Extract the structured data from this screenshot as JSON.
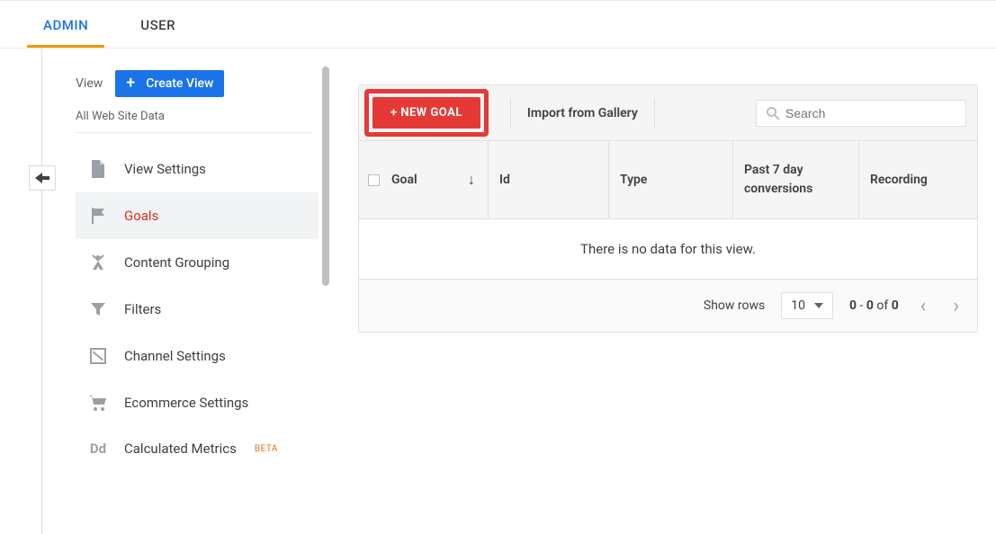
{
  "tabs": {
    "admin": "ADMIN",
    "user": "USER"
  },
  "sidebar": {
    "view_label": "View",
    "create_view": "Create View",
    "property": "All Web Site Data",
    "items": [
      {
        "label": "View Settings"
      },
      {
        "label": "Goals"
      },
      {
        "label": "Content Grouping"
      },
      {
        "label": "Filters"
      },
      {
        "label": "Channel Settings"
      },
      {
        "label": "Ecommerce Settings"
      },
      {
        "label": "Calculated Metrics",
        "badge": "BETA"
      }
    ]
  },
  "toolbar": {
    "new_goal": "+ NEW GOAL",
    "import": "Import from Gallery",
    "search_placeholder": "Search"
  },
  "table": {
    "headers": {
      "goal": "Goal",
      "id": "Id",
      "type": "Type",
      "p7": "Past 7 day conversions",
      "recording": "Recording"
    },
    "empty": "There is no data for this view."
  },
  "footer": {
    "show_rows": "Show rows",
    "rows_value": "10",
    "range_from": "0",
    "range_to": "0",
    "of_label": "of",
    "total": "0"
  }
}
